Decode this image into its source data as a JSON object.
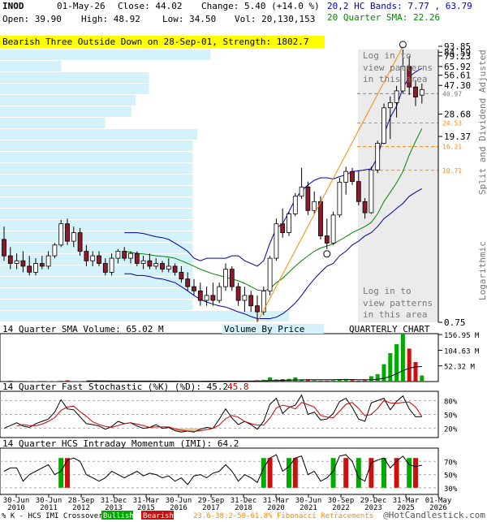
{
  "header": {
    "symbol": "INOD",
    "date": "01-May-26",
    "close": "Close: 44.02",
    "change": "Change: 5.40 (+14.0 %)",
    "open": "Open: 39.90",
    "high": "High: 48.92",
    "low": "Low: 34.50",
    "vol": "Vol: 20,130,153",
    "bands": "20,2 HC Bands: 7.77 , 63.79",
    "sma": "20 Quarter SMA: 22.26"
  },
  "pattern_banner": "Bearish Three Outside Down on 28-Sep-01, Strength: 1802.7",
  "login_text": [
    "Log in to",
    "view patterns",
    "in this area"
  ],
  "price_axis_labels": [
    {
      "value": 93.85,
      "label": "93.85"
    },
    {
      "value": 84.59,
      "label": "84.59"
    },
    {
      "value": 79.23,
      "label": "79.23"
    },
    {
      "value": 65.92,
      "label": "65.92"
    },
    {
      "value": 56.61,
      "label": "56.61"
    },
    {
      "value": 47.3,
      "label": "47.30"
    },
    {
      "value": 40.97,
      "label": "40.97"
    },
    {
      "value": 28.68,
      "label": "28.68"
    },
    {
      "value": 24.53,
      "label": "24.53"
    },
    {
      "value": 19.37,
      "label": "19.37"
    },
    {
      "value": 16.21,
      "label": "16.21"
    },
    {
      "value": 10.71,
      "label": "10.71"
    },
    {
      "value": 0.75,
      "label": "0.75"
    }
  ],
  "fib_levels": [
    24.53,
    16.21,
    10.71
  ],
  "right_title": "Split and Dividend Adjusted",
  "right_scale": "Logarithmic",
  "volume_panel": {
    "title": "14 Quarter SMA Volume: 65.02 M",
    "center_label": "Volume By Price",
    "right_label": "QUARTERLY CHART",
    "axis_labels": [
      "156.95 M",
      "104.63 M",
      "52.32 M"
    ],
    "axis_values": [
      156.95,
      104.63,
      52.32
    ]
  },
  "stoch_panel": {
    "title": "14 Quarter Fast Stochastic (%K) (%D): 45.2",
    "d_value": "45.8",
    "axis_labels": [
      "80%",
      "50%",
      "20%"
    ]
  },
  "imi_panel": {
    "title": "14 Quarter HCS Intraday Momentum (IMI): 64.2",
    "axis_labels": [
      "70%",
      "50%",
      "30%"
    ]
  },
  "x_labels": [
    [
      "30-Jun",
      "2010"
    ],
    [
      "30-Jun",
      "2011"
    ],
    [
      "28-Sep",
      "2012"
    ],
    [
      "31-Dec",
      "2013"
    ],
    [
      "31-Mar",
      "2015"
    ],
    [
      "30-Jun",
      "2016"
    ],
    [
      "29-Sep",
      "2017"
    ],
    [
      "31-Dec",
      "2018"
    ],
    [
      "31-Mar",
      "2020"
    ],
    [
      "30-Jun",
      "2021"
    ],
    [
      "30-Sep",
      "2022"
    ],
    [
      "29-Dec",
      "2023"
    ],
    [
      "31-Mar",
      "2025"
    ],
    [
      "01-May",
      "2026"
    ]
  ],
  "footer": {
    "legend": "% K - HCS IMI Crossover:",
    "bullish": "Bullish",
    "bearish": "Bearish",
    "fib": "23.6-38.2-50-61.8% Fibonacci Retracements",
    "copyright": "@HotCandlestick.com"
  },
  "colors": {
    "up": "#00aa00",
    "down": "#cc1010",
    "candle_down": "#8b1a2b",
    "vbp": "#d4f2fa",
    "sma": "#008800",
    "bands": "#0000aa",
    "banner": "#ffff00",
    "fib": "#ff8800"
  },
  "chart_data": {
    "type": "candlestick",
    "title": "INOD",
    "y_scale": "log",
    "ylim": [
      0.75,
      93.85
    ],
    "x_start": "2010-Q1",
    "x_end": "2026-Q2",
    "candles": [
      {
        "o": 3.2,
        "h": 4.0,
        "l": 2.2,
        "c": 2.4
      },
      {
        "o": 2.4,
        "h": 2.8,
        "l": 1.9,
        "c": 2.1
      },
      {
        "o": 2.1,
        "h": 2.5,
        "l": 1.9,
        "c": 2.2
      },
      {
        "o": 2.2,
        "h": 2.6,
        "l": 1.8,
        "c": 2.0
      },
      {
        "o": 2.0,
        "h": 2.4,
        "l": 1.7,
        "c": 1.8
      },
      {
        "o": 1.8,
        "h": 2.3,
        "l": 1.7,
        "c": 2.1
      },
      {
        "o": 2.1,
        "h": 2.4,
        "l": 1.9,
        "c": 2.0
      },
      {
        "o": 2.0,
        "h": 2.6,
        "l": 1.9,
        "c": 2.4
      },
      {
        "o": 2.4,
        "h": 3.0,
        "l": 2.3,
        "c": 2.9
      },
      {
        "o": 2.9,
        "h": 4.5,
        "l": 2.8,
        "c": 4.2
      },
      {
        "o": 4.2,
        "h": 4.6,
        "l": 2.9,
        "c": 3.1
      },
      {
        "o": 3.1,
        "h": 4.0,
        "l": 2.8,
        "c": 3.6
      },
      {
        "o": 3.6,
        "h": 3.9,
        "l": 2.4,
        "c": 2.6
      },
      {
        "o": 2.6,
        "h": 2.9,
        "l": 2.0,
        "c": 2.2
      },
      {
        "o": 2.2,
        "h": 2.6,
        "l": 2.0,
        "c": 2.4
      },
      {
        "o": 2.4,
        "h": 2.6,
        "l": 2.0,
        "c": 2.1
      },
      {
        "o": 2.1,
        "h": 2.3,
        "l": 1.7,
        "c": 1.8
      },
      {
        "o": 1.8,
        "h": 2.5,
        "l": 1.7,
        "c": 2.3
      },
      {
        "o": 2.3,
        "h": 2.7,
        "l": 2.1,
        "c": 2.6
      },
      {
        "o": 2.6,
        "h": 2.8,
        "l": 2.2,
        "c": 2.3
      },
      {
        "o": 2.3,
        "h": 2.6,
        "l": 2.1,
        "c": 2.5
      },
      {
        "o": 2.5,
        "h": 2.6,
        "l": 2.0,
        "c": 2.1
      },
      {
        "o": 2.1,
        "h": 2.4,
        "l": 1.9,
        "c": 2.2
      },
      {
        "o": 2.2,
        "h": 2.5,
        "l": 1.9,
        "c": 2.0
      },
      {
        "o": 2.0,
        "h": 2.3,
        "l": 1.9,
        "c": 2.1
      },
      {
        "o": 2.1,
        "h": 2.2,
        "l": 1.8,
        "c": 1.9
      },
      {
        "o": 1.9,
        "h": 2.3,
        "l": 1.8,
        "c": 2.0
      },
      {
        "o": 2.0,
        "h": 2.1,
        "l": 1.7,
        "c": 1.8
      },
      {
        "o": 1.8,
        "h": 2.0,
        "l": 1.5,
        "c": 1.6
      },
      {
        "o": 1.6,
        "h": 1.8,
        "l": 1.3,
        "c": 1.4
      },
      {
        "o": 1.4,
        "h": 1.6,
        "l": 1.2,
        "c": 1.3
      },
      {
        "o": 1.3,
        "h": 1.5,
        "l": 1.0,
        "c": 1.1
      },
      {
        "o": 1.1,
        "h": 1.4,
        "l": 1.0,
        "c": 1.2
      },
      {
        "o": 1.2,
        "h": 1.5,
        "l": 1.0,
        "c": 1.1
      },
      {
        "o": 1.1,
        "h": 1.5,
        "l": 1.05,
        "c": 1.4
      },
      {
        "o": 1.4,
        "h": 2.1,
        "l": 1.3,
        "c": 1.9
      },
      {
        "o": 1.9,
        "h": 2.0,
        "l": 1.3,
        "c": 1.4
      },
      {
        "o": 1.4,
        "h": 1.5,
        "l": 1.0,
        "c": 1.1
      },
      {
        "o": 1.1,
        "h": 1.4,
        "l": 0.9,
        "c": 1.2
      },
      {
        "o": 1.2,
        "h": 1.3,
        "l": 0.9,
        "c": 1.0
      },
      {
        "o": 1.0,
        "h": 1.2,
        "l": 0.75,
        "c": 0.9
      },
      {
        "o": 0.9,
        "h": 1.4,
        "l": 0.85,
        "c": 1.3
      },
      {
        "o": 1.3,
        "h": 2.4,
        "l": 1.2,
        "c": 2.3
      },
      {
        "o": 2.3,
        "h": 4.6,
        "l": 2.2,
        "c": 4.2
      },
      {
        "o": 4.2,
        "h": 5.5,
        "l": 3.3,
        "c": 3.6
      },
      {
        "o": 3.6,
        "h": 5.2,
        "l": 3.4,
        "c": 5.0
      },
      {
        "o": 5.0,
        "h": 7.2,
        "l": 4.8,
        "c": 6.8
      },
      {
        "o": 6.8,
        "h": 11.2,
        "l": 6.5,
        "c": 8.0
      },
      {
        "o": 8.0,
        "h": 8.8,
        "l": 4.9,
        "c": 5.3
      },
      {
        "o": 5.3,
        "h": 7.4,
        "l": 5.0,
        "c": 6.2
      },
      {
        "o": 6.2,
        "h": 6.8,
        "l": 3.2,
        "c": 3.4
      },
      {
        "o": 3.4,
        "h": 4.6,
        "l": 2.7,
        "c": 3.0
      },
      {
        "o": 3.0,
        "h": 5.2,
        "l": 2.9,
        "c": 4.9
      },
      {
        "o": 4.9,
        "h": 9.4,
        "l": 4.7,
        "c": 8.7
      },
      {
        "o": 8.7,
        "h": 11.4,
        "l": 7.0,
        "c": 10.5
      },
      {
        "o": 10.5,
        "h": 11.2,
        "l": 8.3,
        "c": 8.8
      },
      {
        "o": 8.8,
        "h": 10.5,
        "l": 5.8,
        "c": 6.2
      },
      {
        "o": 6.2,
        "h": 6.6,
        "l": 4.6,
        "c": 5.1
      },
      {
        "o": 5.1,
        "h": 11.4,
        "l": 5.0,
        "c": 10.8
      },
      {
        "o": 10.8,
        "h": 18.0,
        "l": 10.2,
        "c": 17.2
      },
      {
        "o": 17.2,
        "h": 34.5,
        "l": 16.9,
        "c": 32.0
      },
      {
        "o": 32.0,
        "h": 39.0,
        "l": 18.5,
        "c": 35.0
      },
      {
        "o": 35.0,
        "h": 47.0,
        "l": 27.0,
        "c": 43.0
      },
      {
        "o": 43.0,
        "h": 94.0,
        "l": 41.0,
        "c": 66.0
      },
      {
        "o": 66.0,
        "h": 79.0,
        "l": 40.0,
        "c": 46.0
      },
      {
        "o": 46.0,
        "h": 52.0,
        "l": 33.0,
        "c": 38.6
      },
      {
        "o": 39.9,
        "h": 48.92,
        "l": 34.5,
        "c": 44.02
      }
    ],
    "volume_m": [
      2,
      3,
      2,
      2,
      1,
      1,
      2,
      1,
      1,
      3,
      4,
      2,
      1,
      1,
      2,
      2,
      2,
      1,
      1,
      1,
      1,
      1,
      2,
      1,
      1,
      1,
      1,
      1,
      1,
      1,
      2,
      2,
      2,
      1,
      3,
      2,
      2,
      1,
      2,
      2,
      4,
      6,
      14,
      7,
      8,
      9,
      14,
      6,
      5,
      4,
      3,
      3,
      4,
      8,
      6,
      5,
      3,
      4,
      18,
      25,
      58,
      95,
      125,
      160,
      110,
      65,
      20
    ],
    "vbp_widths": [
      0.48,
      0.14,
      0.34,
      0.34,
      0.31,
      0.3,
      0.24,
      0.45,
      0.44,
      0.44,
      0.44,
      0.44,
      0.44,
      0.44,
      0.44,
      0.44,
      0.44,
      0.44,
      0.44,
      0.44,
      0.44,
      0.44,
      0.44,
      0.66
    ],
    "bands": {
      "upper": [
        null,
        null,
        null,
        null,
        null,
        null,
        null,
        null,
        null,
        null,
        null,
        null,
        null,
        null,
        null,
        null,
        null,
        null,
        null,
        3.6,
        3.6,
        3.6,
        3.55,
        3.45,
        3.35,
        3.3,
        3.2,
        3.0,
        2.8,
        2.6,
        2.3,
        2.2,
        2.3,
        2.3,
        2.3,
        2.3,
        2.4,
        2.4,
        2.2,
        2.1,
        2.0,
        2.2,
        3.0,
        3.9,
        4.2,
        5.2,
        6.5,
        7.5,
        8.3,
        9.0,
        9.4,
        9.4,
        9.2,
        9.6,
        9.9,
        10.5,
        10.6,
        10.8,
        11.0,
        13.5,
        20.0,
        27.0,
        33.0,
        45.0,
        55.0,
        60.0,
        63.79
      ],
      "lower": [
        null,
        null,
        null,
        null,
        null,
        null,
        null,
        null,
        null,
        null,
        null,
        null,
        null,
        null,
        null,
        null,
        null,
        null,
        null,
        1.75,
        1.75,
        1.7,
        1.7,
        1.67,
        1.62,
        1.6,
        1.55,
        1.5,
        1.4,
        1.3,
        1.2,
        1.12,
        1.07,
        1.03,
        1.0,
        0.98,
        0.94,
        0.9,
        0.87,
        0.83,
        0.8,
        0.8,
        0.8,
        0.82,
        0.87,
        0.95,
        1.05,
        1.2,
        1.4,
        1.6,
        1.8,
        2.0,
        2.1,
        2.4,
        2.6,
        2.9,
        3.1,
        3.4,
        3.6,
        4.0,
        4.6,
        5.0,
        5.5,
        6.0,
        6.8,
        7.3,
        7.77
      ]
    },
    "sma20": [
      null,
      null,
      null,
      null,
      null,
      null,
      null,
      null,
      null,
      null,
      null,
      null,
      null,
      null,
      null,
      null,
      null,
      null,
      null,
      2.6,
      2.55,
      2.5,
      2.48,
      2.45,
      2.4,
      2.38,
      2.35,
      2.3,
      2.2,
      2.1,
      2.0,
      1.9,
      1.82,
      1.75,
      1.7,
      1.65,
      1.6,
      1.55,
      1.48,
      1.4,
      1.32,
      1.3,
      1.35,
      1.5,
      1.62,
      1.8,
      2.0,
      2.2,
      2.4,
      2.6,
      2.75,
      2.85,
      2.95,
      3.15,
      3.35,
      3.6,
      3.8,
      4.0,
      4.3,
      5.0,
      6.2,
      7.3,
      8.6,
      10.5,
      14.0,
      17.8,
      22.26
    ],
    "stoch_k": [
      20,
      26,
      32,
      25,
      22,
      30,
      35,
      40,
      55,
      82,
      62,
      60,
      45,
      30,
      28,
      25,
      18,
      24,
      35,
      30,
      32,
      25,
      20,
      22,
      28,
      20,
      22,
      15,
      12,
      14,
      12,
      18,
      22,
      20,
      40,
      62,
      42,
      28,
      35,
      28,
      18,
      35,
      72,
      85,
      52,
      65,
      70,
      92,
      50,
      55,
      38,
      40,
      52,
      78,
      85,
      65,
      40,
      35,
      75,
      80,
      85,
      60,
      78,
      90,
      62,
      45,
      45.2
    ],
    "stoch_d": [
      null,
      null,
      25,
      28,
      26,
      26,
      29,
      35,
      43,
      59,
      66,
      68,
      56,
      46,
      34,
      28,
      24,
      22,
      26,
      30,
      32,
      29,
      26,
      22,
      23,
      23,
      23,
      19,
      16,
      14,
      13,
      15,
      17,
      20,
      27,
      41,
      48,
      44,
      35,
      30,
      27,
      27,
      42,
      64,
      70,
      67,
      62,
      76,
      71,
      66,
      48,
      44,
      43,
      57,
      72,
      76,
      63,
      47,
      50,
      63,
      80,
      75,
      74,
      76,
      77,
      66,
      45.8
    ],
    "imi": [
      55,
      60,
      60,
      40,
      50,
      55,
      60,
      65,
      50,
      55,
      72,
      75,
      70,
      50,
      45,
      40,
      45,
      55,
      50,
      45,
      50,
      55,
      48,
      52,
      50,
      45,
      48,
      40,
      45,
      35,
      48,
      50,
      45,
      52,
      55,
      65,
      55,
      40,
      50,
      45,
      38,
      60,
      75,
      80,
      55,
      62,
      75,
      78,
      50,
      55,
      40,
      45,
      55,
      78,
      80,
      70,
      45,
      40,
      68,
      72,
      75,
      60,
      70,
      78,
      65,
      62,
      64.2
    ],
    "imi_signals": [
      {
        "i": 9,
        "t": "bull"
      },
      {
        "i": 10,
        "t": "bear"
      },
      {
        "i": 41,
        "t": "bull"
      },
      {
        "i": 42,
        "t": "bear"
      },
      {
        "i": 45,
        "t": "bull"
      },
      {
        "i": 46,
        "t": "bear"
      },
      {
        "i": 52,
        "t": "bull"
      },
      {
        "i": 54,
        "t": "bear"
      },
      {
        "i": 56,
        "t": "bull"
      },
      {
        "i": 58,
        "t": "bear"
      },
      {
        "i": 60,
        "t": "bull"
      },
      {
        "i": 62,
        "t": "bear"
      },
      {
        "i": 64,
        "t": "bull"
      },
      {
        "i": 65,
        "t": "bear"
      }
    ]
  }
}
